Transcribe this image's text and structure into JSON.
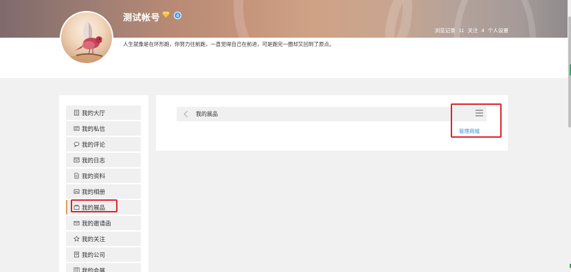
{
  "profile": {
    "name": "测试帐号",
    "level": "4",
    "bio": "人生就像是在环形跑，你努力往前跑，一直觉得自己在前进，可是跑完一圈却又回到了原点。",
    "stats": {
      "views_label": "浏览记录",
      "views_count": "11",
      "follow_label": "关注",
      "follow_count": "4",
      "settings_label": "个人设置"
    }
  },
  "sidebar": {
    "items": [
      {
        "label": "我的大厅",
        "icon": "building-icon"
      },
      {
        "label": "我的私信",
        "icon": "message-icon"
      },
      {
        "label": "我的评论",
        "icon": "comment-icon"
      },
      {
        "label": "我的日志",
        "icon": "journal-icon"
      },
      {
        "label": "我的资料",
        "icon": "profile-doc-icon"
      },
      {
        "label": "我的相册",
        "icon": "photo-album-icon"
      },
      {
        "label": "我的展品",
        "icon": "exhibit-icon"
      },
      {
        "label": "我的邀请函",
        "icon": "envelope-icon"
      },
      {
        "label": "我的关注",
        "icon": "star-icon"
      },
      {
        "label": "我的公司",
        "icon": "company-icon"
      },
      {
        "label": "我的会展",
        "icon": "grid-icon"
      }
    ],
    "active_index": 6
  },
  "content": {
    "title": "我的展品",
    "manage_link": "管理商城"
  },
  "colors": {
    "accent": "#d6a05a",
    "highlight_box": "#e0202a",
    "link": "#3b8fd6",
    "level_badge": "#3fa4e8"
  }
}
